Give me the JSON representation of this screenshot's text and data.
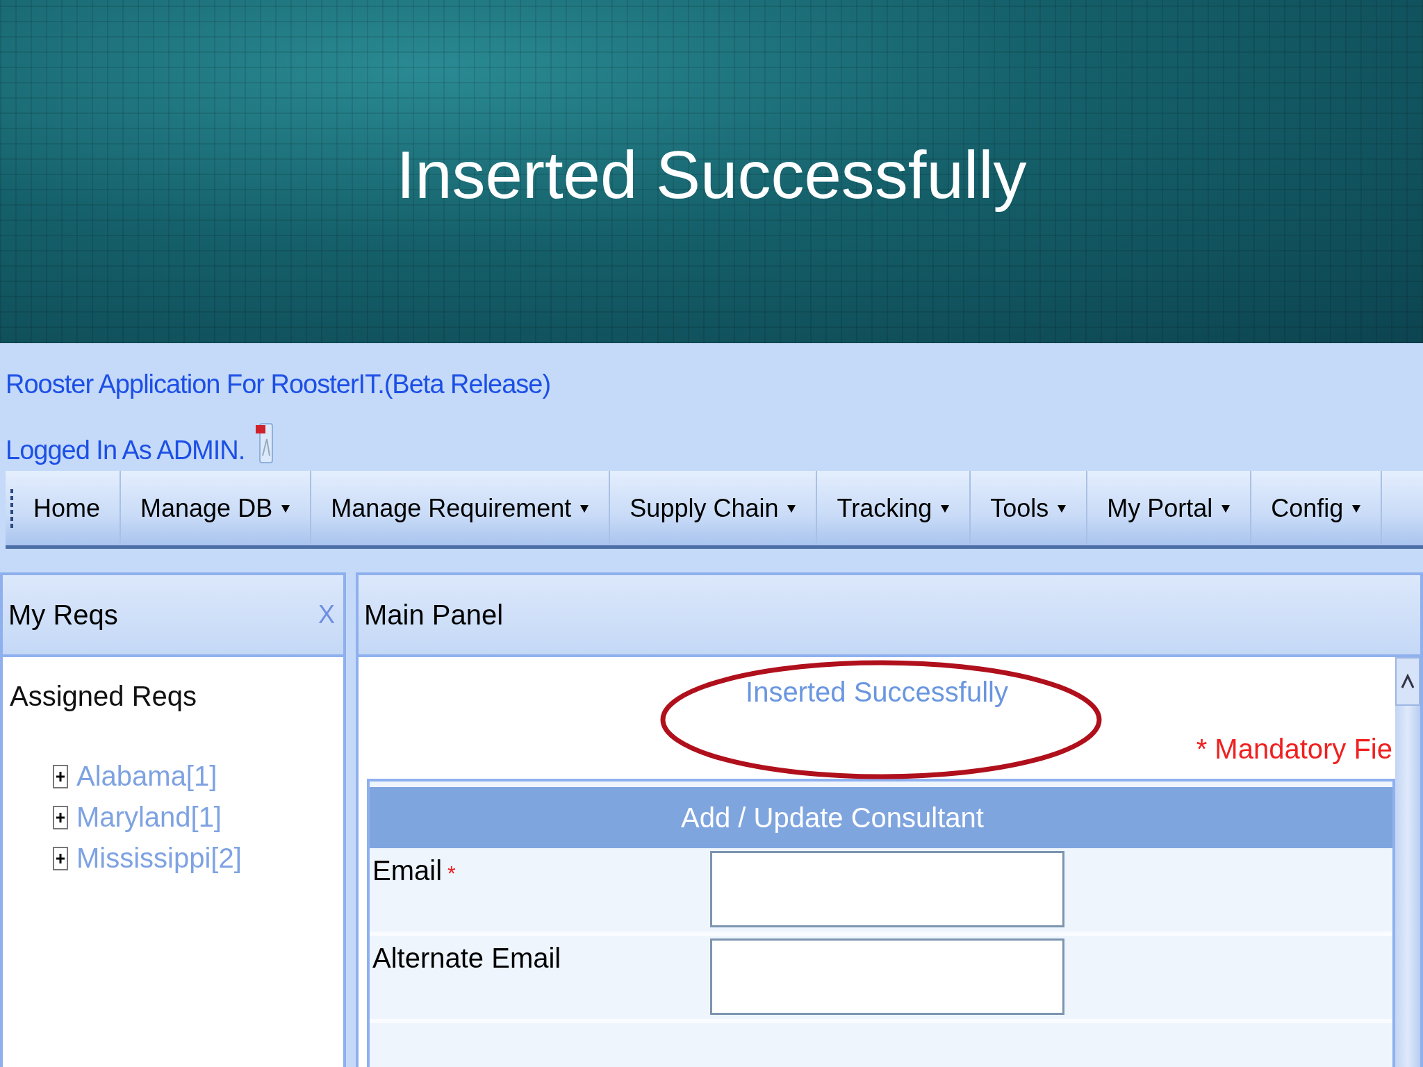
{
  "slide": {
    "title": "Inserted Successfully"
  },
  "app": {
    "title": "Rooster Application For RoosterIT.(Beta Release)",
    "user": "Logged In As ADMIN."
  },
  "menu": [
    {
      "label": "Home",
      "dropdown": false
    },
    {
      "label": "Manage DB",
      "dropdown": true
    },
    {
      "label": "Manage Requirement",
      "dropdown": true
    },
    {
      "label": "Supply Chain",
      "dropdown": true
    },
    {
      "label": "Tracking",
      "dropdown": true
    },
    {
      "label": "Tools",
      "dropdown": true
    },
    {
      "label": "My Portal",
      "dropdown": true
    },
    {
      "label": "Config",
      "dropdown": true
    }
  ],
  "side_panel": {
    "title": "My Reqs",
    "close": "X",
    "section": "Assigned Reqs",
    "tree": [
      {
        "label": "Alabama[1]",
        "expanded": false
      },
      {
        "label": "Maryland[1]",
        "expanded": false
      },
      {
        "label": "Mississippi[2]",
        "expanded": false
      }
    ]
  },
  "main_panel": {
    "title": "Main Panel",
    "message": "Inserted Successfully",
    "mandatory_note": "* Mandatory Fie",
    "form": {
      "title": "Add / Update Consultant",
      "fields": [
        {
          "label": "Email",
          "required_mark": "*"
        },
        {
          "label": "Alternate Email"
        }
      ]
    }
  }
}
